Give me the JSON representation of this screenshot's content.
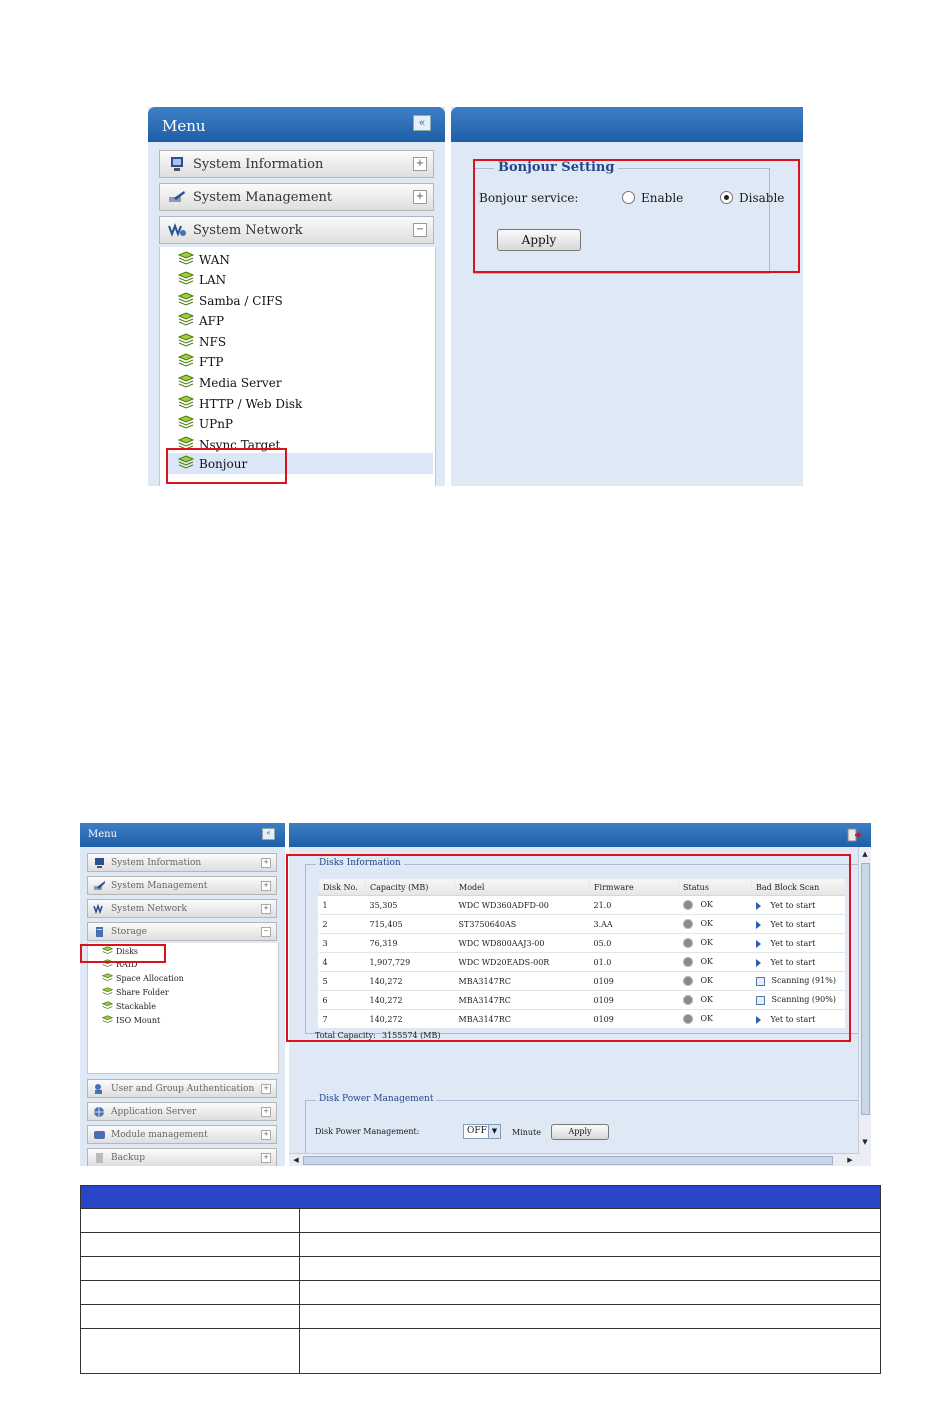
{
  "screenshot1": {
    "menu_title": "Menu",
    "collapse_symbol": "«",
    "groups": [
      {
        "label": "System Information",
        "toggle": "+",
        "icon": "monitor-icon"
      },
      {
        "label": "System Management",
        "toggle": "+",
        "icon": "tools-icon"
      },
      {
        "label": "System Network",
        "toggle": "−",
        "icon": "network-icon"
      }
    ],
    "network_items": [
      "WAN",
      "LAN",
      "Samba / CIFS",
      "AFP",
      "NFS",
      "FTP",
      "Media Server",
      "HTTP / Web Disk",
      "UPnP",
      "Nsync Target",
      "Bonjour"
    ],
    "selected_item": "Bonjour",
    "setting": {
      "legend": "Bonjour Setting",
      "service_label": "Bonjour service:",
      "enable_label": "Enable",
      "disable_label": "Disable",
      "selected": "Disable",
      "apply_label": "Apply"
    },
    "colors": {
      "header": "#1f5ea8",
      "panel": "#dfe8f5",
      "highlight": "#d9121b"
    }
  },
  "screenshot2": {
    "menu_title": "Menu",
    "collapse_symbol": "«",
    "groups_top": [
      {
        "label": "System Information",
        "toggle": "+"
      },
      {
        "label": "System Management",
        "toggle": "+"
      },
      {
        "label": "System Network",
        "toggle": "+"
      },
      {
        "label": "Storage",
        "toggle": "−"
      }
    ],
    "storage_items": [
      "Disks",
      "RAID",
      "Space Allocation",
      "Share Folder",
      "Stackable",
      "ISO Mount"
    ],
    "groups_bottom": [
      {
        "label": "User and Group Authentication",
        "toggle": "+"
      },
      {
        "label": "Application Server",
        "toggle": "+"
      },
      {
        "label": "Module management",
        "toggle": "+"
      },
      {
        "label": "Backup",
        "toggle": "+"
      }
    ],
    "disks_legend": "Disks Information",
    "columns": [
      "Disk No.",
      "Capacity (MB)",
      "Model",
      "Firmware",
      "Status",
      "Bad Block Scan"
    ],
    "rows": [
      {
        "no": "1",
        "capacity": "35,305",
        "model": "WDC WD360ADFD-00",
        "firmware": "21.0",
        "status": "OK",
        "scan": "Yet to start",
        "scan_kind": "play"
      },
      {
        "no": "2",
        "capacity": "715,405",
        "model": "ST3750640AS",
        "firmware": "3.AA",
        "status": "OK",
        "scan": "Yet to start",
        "scan_kind": "play"
      },
      {
        "no": "3",
        "capacity": "76,319",
        "model": "WDC WD800AAJ3-00",
        "firmware": "05.0",
        "status": "OK",
        "scan": "Yet to start",
        "scan_kind": "play"
      },
      {
        "no": "4",
        "capacity": "1,907,729",
        "model": "WDC WD20EADS-00R",
        "firmware": "01.0",
        "status": "OK",
        "scan": "Yet to start",
        "scan_kind": "play"
      },
      {
        "no": "5",
        "capacity": "140,272",
        "model": "MBA3147RC",
        "firmware": "0109",
        "status": "OK",
        "scan": "Scanning (91%)",
        "scan_kind": "box"
      },
      {
        "no": "6",
        "capacity": "140,272",
        "model": "MBA3147RC",
        "firmware": "0109",
        "status": "OK",
        "scan": "Scanning (90%)",
        "scan_kind": "box"
      },
      {
        "no": "7",
        "capacity": "140,272",
        "model": "MBA3147RC",
        "firmware": "0109",
        "status": "OK",
        "scan": "Yet to start",
        "scan_kind": "play"
      }
    ],
    "total_capacity_label": "Total Capacity:",
    "total_capacity_value": "3155574 (MB)",
    "power_legend": "Disk Power Management",
    "power_label": "Disk Power Management:",
    "power_value": "OFF",
    "minute_label": "Minute",
    "apply_label": "Apply"
  },
  "doc_table": {
    "header_color": "#2a46c8",
    "row_count": 6
  }
}
